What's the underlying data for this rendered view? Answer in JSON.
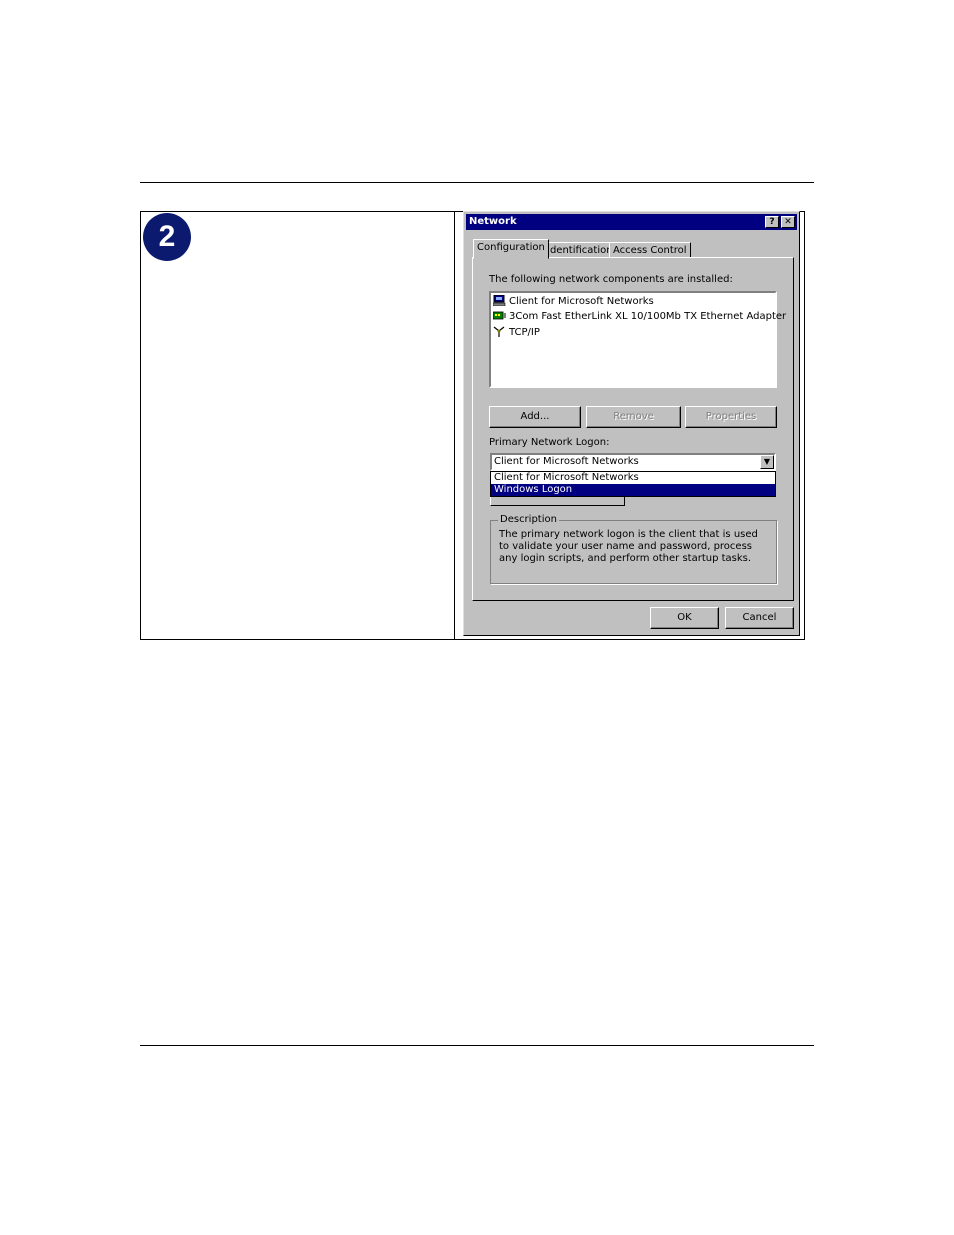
{
  "step": {
    "number": "2"
  },
  "dialog": {
    "title": "Network",
    "help_glyph": "?",
    "close_glyph": "✕",
    "tabs": [
      {
        "label": "Configuration",
        "active": true
      },
      {
        "label": "Identification",
        "active": false
      },
      {
        "label": "Access Control",
        "active": false
      }
    ],
    "components_label": "The following network components are installed:",
    "components": [
      {
        "label": "Client for Microsoft Networks",
        "icon": "client-icon"
      },
      {
        "label": "3Com Fast EtherLink XL 10/100Mb TX Ethernet Adapter",
        "icon": "adapter-icon"
      },
      {
        "label": "TCP/IP",
        "icon": "protocol-icon"
      }
    ],
    "buttons": {
      "add": "Add...",
      "remove": "Remove",
      "properties": "Properties"
    },
    "logon_label": "Primary Network Logon:",
    "logon_value": "Client for Microsoft Networks",
    "logon_options": [
      "Client for Microsoft Networks",
      "Windows Logon"
    ],
    "logon_selected_index": 1,
    "description_title": "Description",
    "description_text": "The primary network logon is the client that is used to validate your user name and password, process any login scripts, and perform other startup tasks.",
    "ok_label": "OK",
    "cancel_label": "Cancel"
  },
  "colors": {
    "badge": "#0b1a6e",
    "titlebar": "#000080",
    "face": "#c0c0c0"
  }
}
